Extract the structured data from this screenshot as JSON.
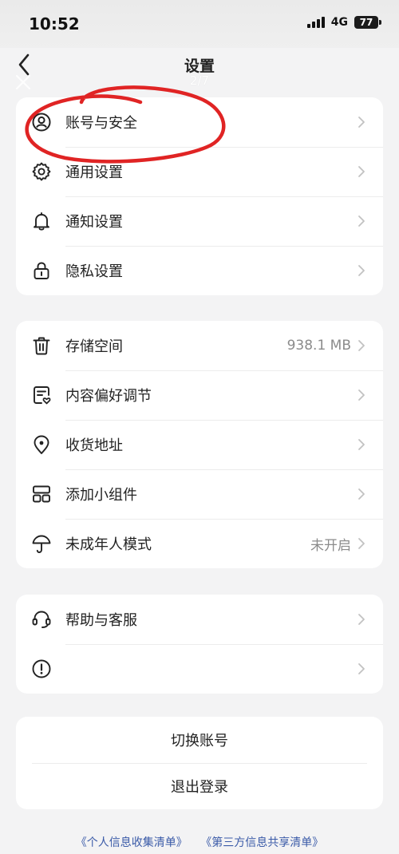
{
  "status": {
    "time": "10:52",
    "network": "4G",
    "battery": "77"
  },
  "nav": {
    "title": "设置",
    "counter": "2/7"
  },
  "groups": {
    "account": [
      {
        "label": "账号与安全",
        "value": ""
      },
      {
        "label": "通用设置",
        "value": ""
      },
      {
        "label": "通知设置",
        "value": ""
      },
      {
        "label": "隐私设置",
        "value": ""
      }
    ],
    "storage": [
      {
        "label": "存储空间",
        "value": "938.1 MB"
      },
      {
        "label": "内容偏好调节",
        "value": ""
      },
      {
        "label": "收货地址",
        "value": ""
      },
      {
        "label": "添加小组件",
        "value": ""
      },
      {
        "label": "未成年人模式",
        "value": "未开启"
      }
    ],
    "support": [
      {
        "label": "帮助与客服",
        "value": ""
      },
      {
        "label": "",
        "value": ""
      }
    ]
  },
  "actions": {
    "switch_account": "切换账号",
    "logout": "退出登录"
  },
  "footer": {
    "privacy_list": "《个人信息收集清单》",
    "third_party_list": "《第三方信息共享清单》"
  },
  "colors": {
    "annotation": "#e02424",
    "link": "#3b5ba8",
    "accent_gray": "#8b8b8b"
  }
}
